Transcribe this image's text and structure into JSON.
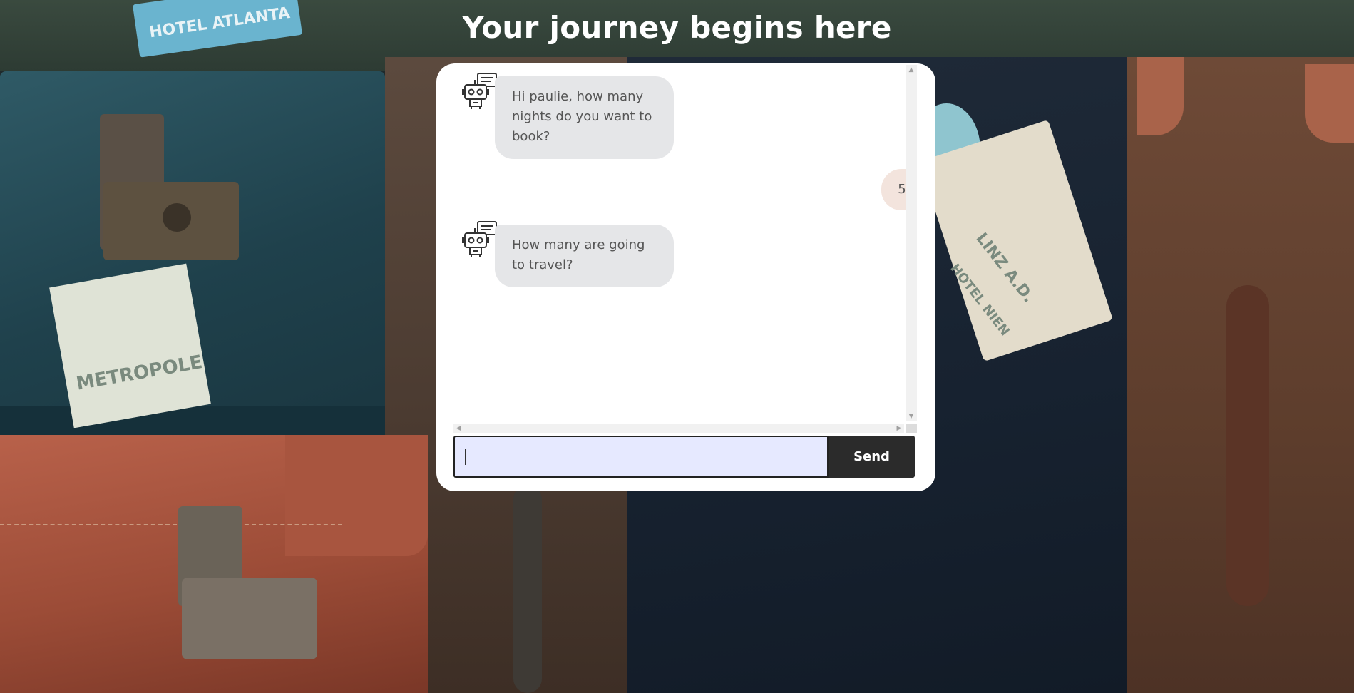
{
  "header": {
    "title": "Your journey begins here"
  },
  "background": {
    "sticker_hotel": "HOTEL ATLANTA",
    "sticker_metropole": "METROPOLE",
    "sticker_linz": "LINZ A.D.",
    "sticker_hotel_nien": "HOTEL NIEN"
  },
  "chat": {
    "messages": [
      {
        "sender": "bot",
        "text": "Hi paulie, how many nights do you want to book?",
        "icon": "robot-icon"
      },
      {
        "sender": "user",
        "text": "5"
      },
      {
        "sender": "bot",
        "text": "How many are going to travel?",
        "icon": "robot-icon"
      }
    ],
    "input": {
      "value": "",
      "placeholder": ""
    },
    "send_label": "Send"
  },
  "colors": {
    "card_bg": "#ffffff",
    "bot_bubble": "#e5e6e8",
    "user_bubble": "#f3e4dd",
    "input_bg": "#e6e9ff",
    "send_button": "#2b2b2b"
  }
}
